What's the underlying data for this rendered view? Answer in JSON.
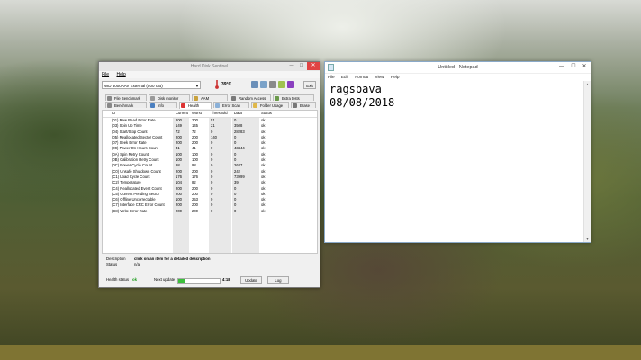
{
  "hds": {
    "title": "Hard Disk Sentinel",
    "menu": [
      "File",
      "Help"
    ],
    "drive": "WD 5000AAV External (500 GB)",
    "temperature": "39°C",
    "exit_label": "Exit",
    "tabs_row1": [
      "File Benchmark",
      "Disk monitor",
      "AAM",
      "Random Access",
      "Extra tests"
    ],
    "tabs_row2": [
      "Benchmark",
      "Info",
      "Health",
      "Error Scan",
      "Folder Usage",
      "Erase"
    ],
    "columns": [
      "ID",
      "Current",
      "Worst",
      "Threshold",
      "Data",
      "Status"
    ],
    "rows": [
      {
        "id": "(01) Raw Read Error Rate",
        "cur": "200",
        "wor": "200",
        "thr": "51",
        "dat": "0",
        "sta": "ok"
      },
      {
        "id": "(03) Spin Up Time",
        "cur": "149",
        "wor": "145",
        "thr": "21",
        "dat": "3508",
        "sta": "ok"
      },
      {
        "id": "(04) Start/Stop Count",
        "cur": "72",
        "wor": "72",
        "thr": "0",
        "dat": "28283",
        "sta": "ok"
      },
      {
        "id": "(05) Reallocated Sector Count",
        "cur": "200",
        "wor": "200",
        "thr": "140",
        "dat": "0",
        "sta": "ok"
      },
      {
        "id": "(07) Seek Error Rate",
        "cur": "200",
        "wor": "200",
        "thr": "0",
        "dat": "0",
        "sta": "ok"
      },
      {
        "id": "(09) Power On Hours Count",
        "cur": "41",
        "wor": "41",
        "thr": "0",
        "dat": "43444",
        "sta": "ok"
      },
      {
        "id": "(0A) Spin Retry Count",
        "cur": "100",
        "wor": "100",
        "thr": "0",
        "dat": "0",
        "sta": "ok"
      },
      {
        "id": "(0B) Calibration Retry Count",
        "cur": "100",
        "wor": "100",
        "thr": "0",
        "dat": "0",
        "sta": "ok"
      },
      {
        "id": "(0C) Power Cycle Count",
        "cur": "98",
        "wor": "98",
        "thr": "0",
        "dat": "2647",
        "sta": "ok"
      },
      {
        "id": "(C0) Unsafe Shutdown Count",
        "cur": "200",
        "wor": "200",
        "thr": "0",
        "dat": "242",
        "sta": "ok"
      },
      {
        "id": "(C1) Load Cycle Count",
        "cur": "176",
        "wor": "176",
        "thr": "0",
        "dat": "73999",
        "sta": "ok"
      },
      {
        "id": "(C2) Temperature",
        "cur": "104",
        "wor": "82",
        "thr": "0",
        "dat": "39",
        "sta": "ok"
      },
      {
        "id": "(C4) Reallocated Event Count",
        "cur": "200",
        "wor": "200",
        "thr": "0",
        "dat": "0",
        "sta": "ok"
      },
      {
        "id": "(C5) Current Pending Sector",
        "cur": "200",
        "wor": "200",
        "thr": "0",
        "dat": "0",
        "sta": "ok"
      },
      {
        "id": "(C6) Offline Uncorrectable",
        "cur": "100",
        "wor": "253",
        "thr": "0",
        "dat": "0",
        "sta": "ok"
      },
      {
        "id": "(C7) Interface CRC Error Count",
        "cur": "200",
        "wor": "200",
        "thr": "0",
        "dat": "0",
        "sta": "ok"
      },
      {
        "id": "(C8) Write Error Rate",
        "cur": "200",
        "wor": "200",
        "thr": "0",
        "dat": "0",
        "sta": "ok"
      }
    ],
    "description_label": "Description",
    "description_value": "click on an item for a detailed description",
    "status_label": "Status",
    "status_value": "n/a",
    "health_status_label": "Health status",
    "health_status_value": "ok",
    "next_update_label": "Next update",
    "next_update_progress": 0.15,
    "next_update_time": "4:18",
    "update_label": "Update",
    "log_label": "Log"
  },
  "notepad": {
    "title": "Untitled - Notepad",
    "menu": [
      "File",
      "Edit",
      "Format",
      "View",
      "Help"
    ],
    "lines": [
      "ragsbava",
      "08/08/2018"
    ]
  },
  "colors": {
    "accent_close": "#e04343",
    "taskbar": "#7f7433",
    "health_ok": "#1a9b1a"
  }
}
